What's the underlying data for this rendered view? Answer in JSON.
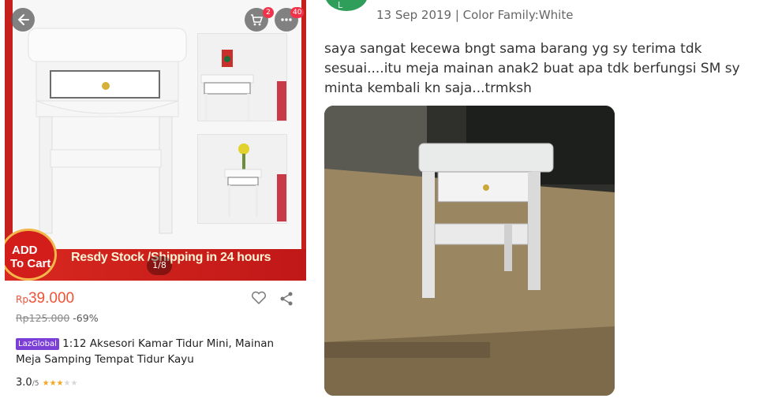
{
  "product": {
    "banner_text": "Resdy Stock /Shipping in 24 hours",
    "add_to_cart_line1": "ADD",
    "add_to_cart_line2": "To Cart",
    "image_pager": "1/8",
    "cart_badge": "2",
    "more_badge": "40",
    "currency": "Rp",
    "price": "39.000",
    "original_price": "Rp125.000",
    "discount": "-69%",
    "store_tag": "LazGlobal",
    "title": "1:12 Aksesori Kamar Tidur Mini, Mainan Meja Samping Tempat Tidur Kayu",
    "rating": "3.0",
    "rating_max": "/5",
    "rating_stars": 3
  },
  "review": {
    "meta": "13 Sep 2019 | Color Family:White",
    "text": "saya sangat kecewa bngt sama barang yg sy terima tdk sesuai....itu meja mainan anak2 buat apa tdk berfungsi SM sy minta kembali kn saja...trmksh",
    "avatar_letter": "L"
  },
  "colors": {
    "accent_red": "#c6201d",
    "price_orange": "#f05235",
    "laz_purple": "#7b3ed6",
    "avatar_green": "#2f9e5b",
    "star_gold": "#f5a623"
  }
}
